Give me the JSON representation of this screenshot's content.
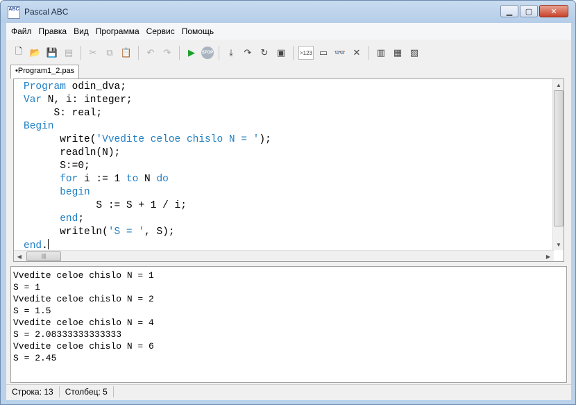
{
  "window": {
    "title": "Pascal ABC",
    "icon_text": "ABC"
  },
  "menu": [
    "Файл",
    "Правка",
    "Вид",
    "Программа",
    "Сервис",
    "Помощь"
  ],
  "toolbar": {
    "num_label": ">123"
  },
  "tabs": [
    {
      "label": "•Program1_2.pas"
    }
  ],
  "code": {
    "l1_kw": "Program",
    "l1_rest": " odin_dva;",
    "l2_kw": "Var",
    "l2_rest": " N, i: integer;",
    "l3": "     S: real;",
    "l4_kw": "Begin",
    "l5_a": "      write(",
    "l5_str": "'Vvedite celoe chislo N = '",
    "l5_b": ");",
    "l6": "      readln(N);",
    "l7": "      S:=0;",
    "l8_pre": "      ",
    "l8_kw1": "for",
    "l8_mid": " i := 1 ",
    "l8_kw2": "to",
    "l8_mid2": " N ",
    "l8_kw3": "do",
    "l9_pre": "      ",
    "l9_kw": "begin",
    "l10": "            S := S + 1 / i;",
    "l11_pre": "      ",
    "l11_kw": "end",
    "l11_rest": ";",
    "l12_a": "      writeln(",
    "l12_str": "'S = '",
    "l12_b": ", S);",
    "l13_kw": "end",
    "l13_rest": "."
  },
  "output_lines": [
    "Vvedite celoe chislo N = 1",
    "S = 1",
    "Vvedite celoe chislo N = 2",
    "S = 1.5",
    "Vvedite celoe chislo N = 4",
    "S = 2.08333333333333",
    "Vvedite celoe chislo N = 6",
    "S = 2.45"
  ],
  "status": {
    "row": "Строка: 13",
    "col": "Столбец: 5"
  },
  "colors": {
    "keyword": "#1f7fc4",
    "titlebar": "#b9d1ea"
  }
}
